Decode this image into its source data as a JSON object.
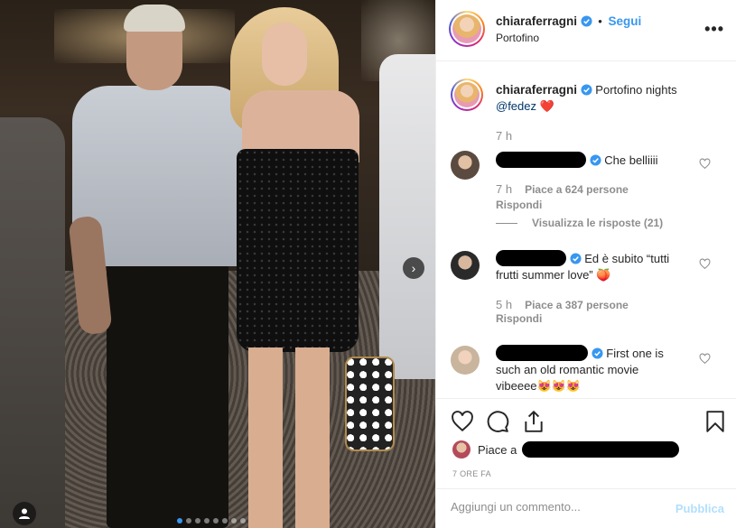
{
  "post": {
    "next_icon": "chevron-right-icon",
    "tag_icon": "user-tag-icon",
    "carousel_count": 8,
    "carousel_active": 1
  },
  "header": {
    "username": "chiaraferragni",
    "separator": "•",
    "follow_label": "Segui",
    "location": "Portofino",
    "more_label": "•••"
  },
  "caption": {
    "username": "chiaraferragni",
    "text": "Portofino nights",
    "mention": "@fedez",
    "emoji": "❤️",
    "time": "7 h"
  },
  "comments": [
    {
      "text": "Che belliiii",
      "time": "7 h",
      "likes": "Piace a 624 persone",
      "reply": "Rispondi",
      "view_replies": "Visualizza le risposte (21)"
    },
    {
      "text_line1": "Ed è subito “tutti",
      "text_line2": "frutti summer love” 🍑",
      "time": "5 h",
      "likes": "Piace a 387 persone",
      "reply": "Rispondi"
    },
    {
      "text_line1": "First one is",
      "text_line2": "such an old romantic movie",
      "text_line3": "vibeeee😻😻😻"
    }
  ],
  "actions": {
    "like_icon": "heart-icon",
    "comment_icon": "comment-icon",
    "share_icon": "share-icon",
    "save_icon": "bookmark-icon",
    "likes_prefix": "Piace a",
    "posted_ago": "7 ORE FA"
  },
  "comment_box": {
    "placeholder": "Aggiungi un commento...",
    "publish_label": "Pubblica"
  },
  "colors": {
    "accent": "#3897f0",
    "like_red": "#ed4956",
    "muted": "#8e8e8e",
    "publish_disabled": "#b2dffc"
  }
}
